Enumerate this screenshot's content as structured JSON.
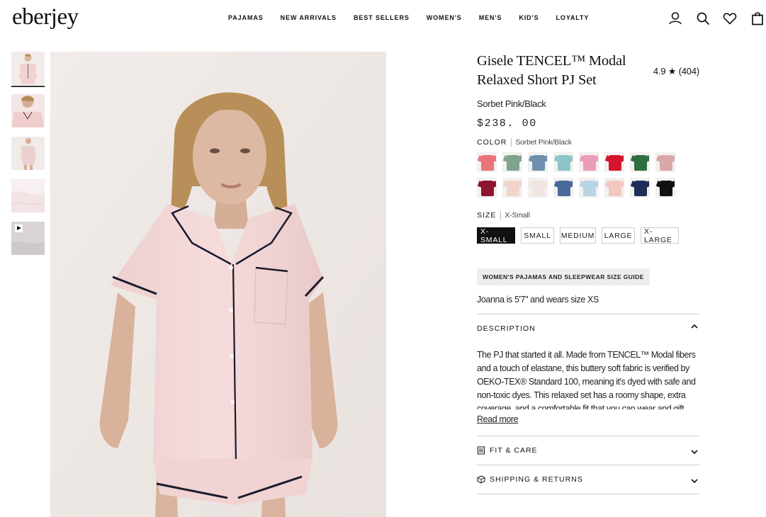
{
  "header": {
    "logo": "eberjey",
    "nav": [
      "PAJAMAS",
      "NEW ARRIVALS",
      "BEST SELLERS",
      "WOMEN'S",
      "MEN'S",
      "KID'S",
      "LOYALTY"
    ],
    "icons": [
      "account-icon",
      "search-icon",
      "wishlist-heart-icon",
      "cart-bag-icon"
    ]
  },
  "gallery": {
    "thumbnails": [
      {
        "name": "thumb-front",
        "bg": "#efd9d8"
      },
      {
        "name": "thumb-closeup",
        "bg": "#f2dfdc"
      },
      {
        "name": "thumb-side",
        "bg": "#ead6d3"
      },
      {
        "name": "thumb-fabric",
        "bg": "#f6eeee"
      },
      {
        "name": "thumb-video",
        "bg": "#d6d0d2",
        "video": true
      }
    ],
    "main_image_alt": "Model wearing pink short pajama set with black piping"
  },
  "product": {
    "title": "Gisele TENCEL™ Modal Relaxed Short PJ Set",
    "rating": "4.9 ★ (404)",
    "color_name": "Sorbet Pink/Black",
    "price": "$238. 00",
    "color_label": "COLOR",
    "color_selected": "Sorbet Pink/Black",
    "swatches": [
      "#e8747a",
      "#7fa38d",
      "#6d8fad",
      "#8dc4c7",
      "#eb9cb6",
      "#d4152c",
      "#2e6e3f",
      "#d9a7a7",
      "#8e1530",
      "#f1d4cb",
      "#f0e4e0",
      "#4a6b99",
      "#b9d3e6",
      "#f1c7bf",
      "#1f2d58",
      "#111111"
    ],
    "size_label": "SIZE",
    "size_selected": "X-Small",
    "sizes": [
      "X-SMALL",
      "SMALL",
      "MEDIUM",
      "LARGE",
      "X-LARGE"
    ],
    "size_guide": "WOMEN'S PAJAMAS AND SLEEPWEAR SIZE GUIDE",
    "model_note": "Joanna is 5'7\" and wears size XS",
    "description_label": "DESCRIPTION",
    "description": "The PJ that started it all. Made from TENCEL™ Modal fibers and a touch of elastane, this buttery soft fabric is verified by OEKO-TEX® Standard 100, meaning it's dyed with safe and non-toxic dyes. This relaxed set has a roomy shape, extra coverage, and a comfortable fit that you can wear and gift with",
    "read_more": "Read more",
    "fit_care_label": "FIT & CARE",
    "shipping_label": "SHIPPING & RETURNS"
  },
  "colors": {
    "text": "#111111",
    "pajama_pink": "#f2d6d5",
    "piping": "#1a1a2e",
    "backdrop": "#efe9e6"
  }
}
